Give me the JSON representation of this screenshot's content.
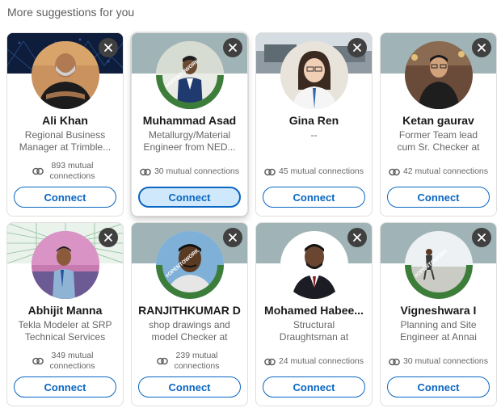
{
  "section_title": "More suggestions for you",
  "connect_label": "Connect",
  "cards": [
    {
      "name": "Ali Khan",
      "headline": "Regional Business Manager at Trimble...",
      "mutual": "893 mutual connections",
      "open_to_work": false
    },
    {
      "name": "Muhammad Asad",
      "headline": "Metallurgy/Material Engineer from NED...",
      "mutual": "30 mutual connections",
      "open_to_work": true
    },
    {
      "name": "Gina Ren",
      "headline": "--",
      "mutual": "45 mutual connections",
      "open_to_work": false
    },
    {
      "name": "Ketan gaurav",
      "headline": "Former Team lead cum Sr. Checker at Vegazv...",
      "mutual": "42 mutual connections",
      "open_to_work": false
    },
    {
      "name": "Abhijit Manna",
      "headline": "Tekla Modeler at SRP Technical Services",
      "mutual": "349 mutual connections",
      "open_to_work": false
    },
    {
      "name": "RANJITHKUMAR D",
      "headline": "shop drawings and model Checker at VB...",
      "mutual": "239 mutual connections",
      "open_to_work": true
    },
    {
      "name": "Mohamed Habee...",
      "headline": "Structural Draughtsman at Exce...",
      "mutual": "24 mutual connections",
      "open_to_work": false
    },
    {
      "name": "Vigneshwara I",
      "headline": "Planning and Site Engineer at Annai Infra",
      "mutual": "30 mutual connections",
      "open_to_work": true
    }
  ],
  "badge_text": "#OPENTOWORK",
  "colors": {
    "brand_blue": "#0a66c2",
    "open_to_work_green": "#3c7d3a",
    "close_button": "#404040",
    "default_banner": "#a0b4b7"
  },
  "icons": {
    "close": "close-icon",
    "mutual": "mutual-connections-icon"
  }
}
